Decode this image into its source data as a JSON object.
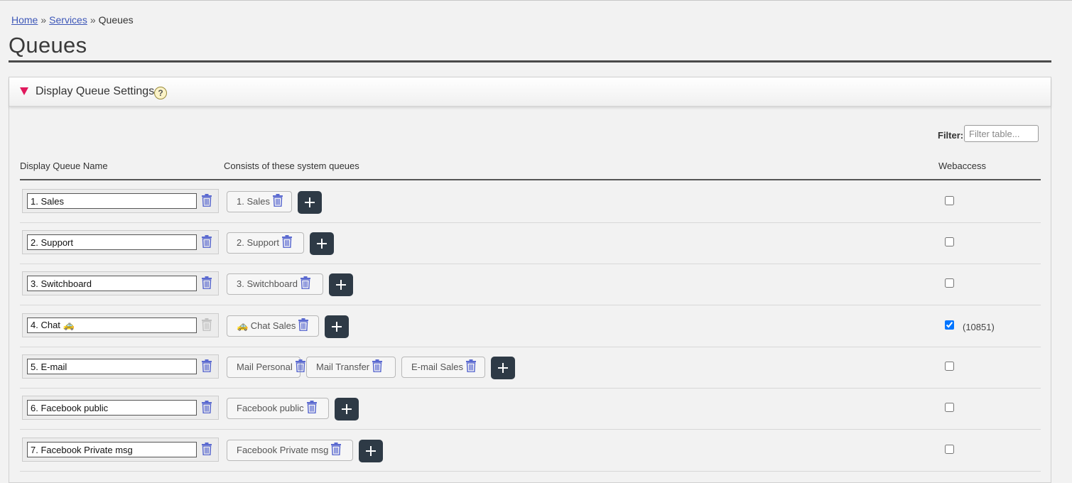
{
  "breadcrumb": {
    "home": "Home",
    "services": "Services",
    "current": "Queues",
    "sep": "»"
  },
  "page_title": "Queues",
  "panel": {
    "title": "Display Queue Settings",
    "help": "?"
  },
  "filter": {
    "label": "Filter:",
    "placeholder": "Filter table..."
  },
  "columns": {
    "name": "Display Queue Name",
    "queues": "Consists of these system queues",
    "web": "Webaccess"
  },
  "rows": [
    {
      "name": "1. Sales",
      "queues": [
        "1. Sales"
      ],
      "web": false,
      "web_count": "",
      "delete_enabled": true
    },
    {
      "name": "2. Support",
      "queues": [
        "2. Support"
      ],
      "web": false,
      "web_count": "",
      "delete_enabled": true
    },
    {
      "name": "3. Switchboard",
      "queues": [
        "3. Switchboard"
      ],
      "web": false,
      "web_count": "",
      "delete_enabled": true
    },
    {
      "name": "4. Chat 🚕",
      "queues": [
        "🚕 Chat Sales"
      ],
      "web": true,
      "web_count": "(10851)",
      "delete_enabled": false
    },
    {
      "name": "5. E-mail",
      "queues": [
        "Mail Personal",
        "Mail Transfer",
        "E-mail Sales"
      ],
      "web": false,
      "web_count": "",
      "delete_enabled": true
    },
    {
      "name": "6. Facebook public",
      "queues": [
        "Facebook public"
      ],
      "web": false,
      "web_count": "",
      "delete_enabled": true
    },
    {
      "name": "7. Facebook Private msg",
      "queues": [
        "Facebook Private msg"
      ],
      "web": false,
      "web_count": "",
      "delete_enabled": true
    }
  ],
  "colors": {
    "accent_triangle": "#e0185c",
    "link": "#3d57b8",
    "add_button": "#2e3a46",
    "trash": "#5b6ad0"
  },
  "icons": [
    "triangle-down-icon",
    "help-icon",
    "trash-icon",
    "plus-icon",
    "car-icon"
  ]
}
